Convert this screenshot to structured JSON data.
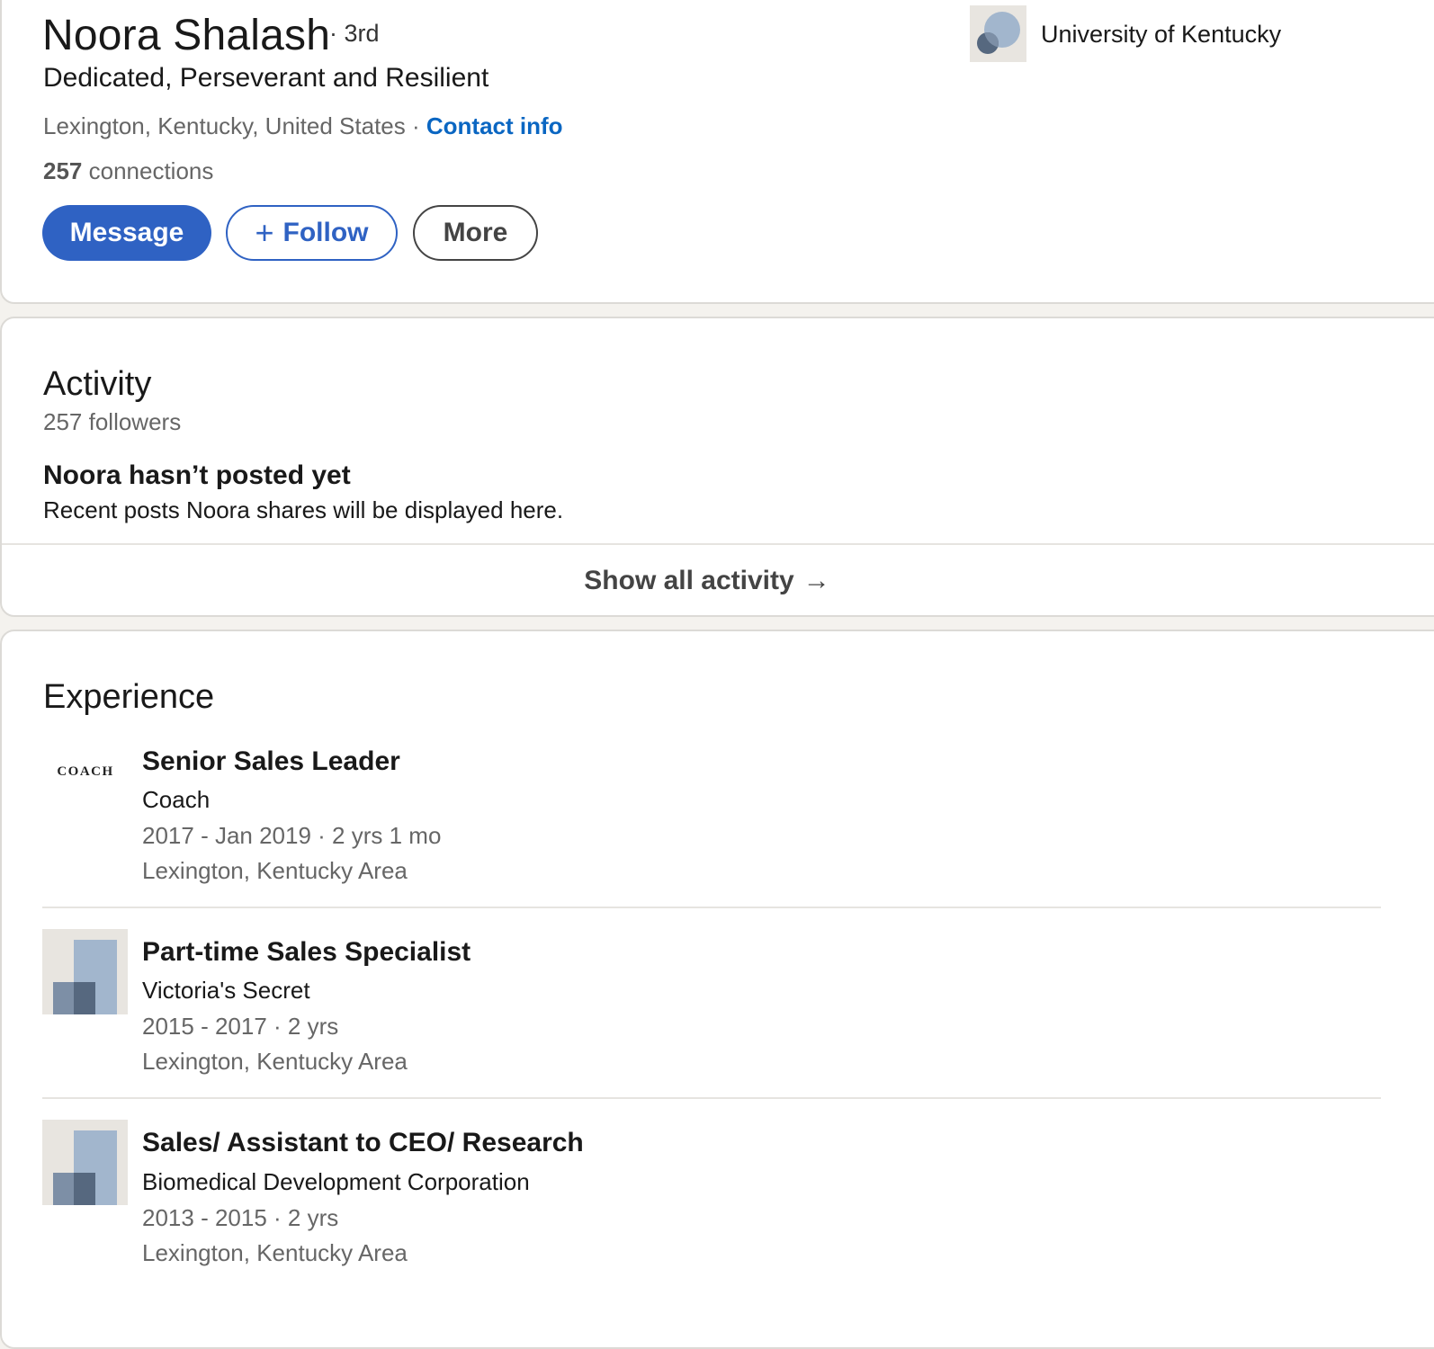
{
  "profile": {
    "name": "Noora Shalash",
    "degree": "· 3rd",
    "headline": "Dedicated, Perseverant and Resilient",
    "location": "Lexington, Kentucky, United States",
    "location_sep": " · ",
    "contact_label": "Contact info",
    "connections_count": "257",
    "connections_label": " connections",
    "education": "University of Kentucky"
  },
  "actions": {
    "message": "Message",
    "follow": "Follow",
    "follow_icon": "+",
    "more": "More"
  },
  "activity": {
    "title": "Activity",
    "followers": "257 followers",
    "empty_title": "Noora hasn’t posted yet",
    "empty_subtitle": "Recent posts Noora shares will be displayed here.",
    "show_all": "Show all activity",
    "show_all_arrow": "→"
  },
  "experience": {
    "title": "Experience",
    "items": [
      {
        "title": "Senior Sales Leader",
        "company": "Coach",
        "dates": "2017 - Jan 2019 · 2 yrs 1 mo",
        "location": "Lexington, Kentucky Area",
        "logo_text": "COACH",
        "logo": "coach-logo"
      },
      {
        "title": "Part-time Sales Specialist",
        "company": "Victoria's Secret",
        "dates": "2015 - 2017 · 2 yrs",
        "location": "Lexington, Kentucky Area",
        "logo": "company-placeholder-logo"
      },
      {
        "title": "Sales/ Assistant to CEO/ Research",
        "company": "Biomedical Development Corporation",
        "dates": "2013 - 2015 · 2 yrs",
        "location": "Lexington, Kentucky Area",
        "logo": "company-placeholder-logo"
      }
    ]
  },
  "colors": {
    "primary": "#2f62c3",
    "link": "#0a66c2",
    "muted_text": "#666666",
    "page_bg": "#f4f2ee"
  }
}
